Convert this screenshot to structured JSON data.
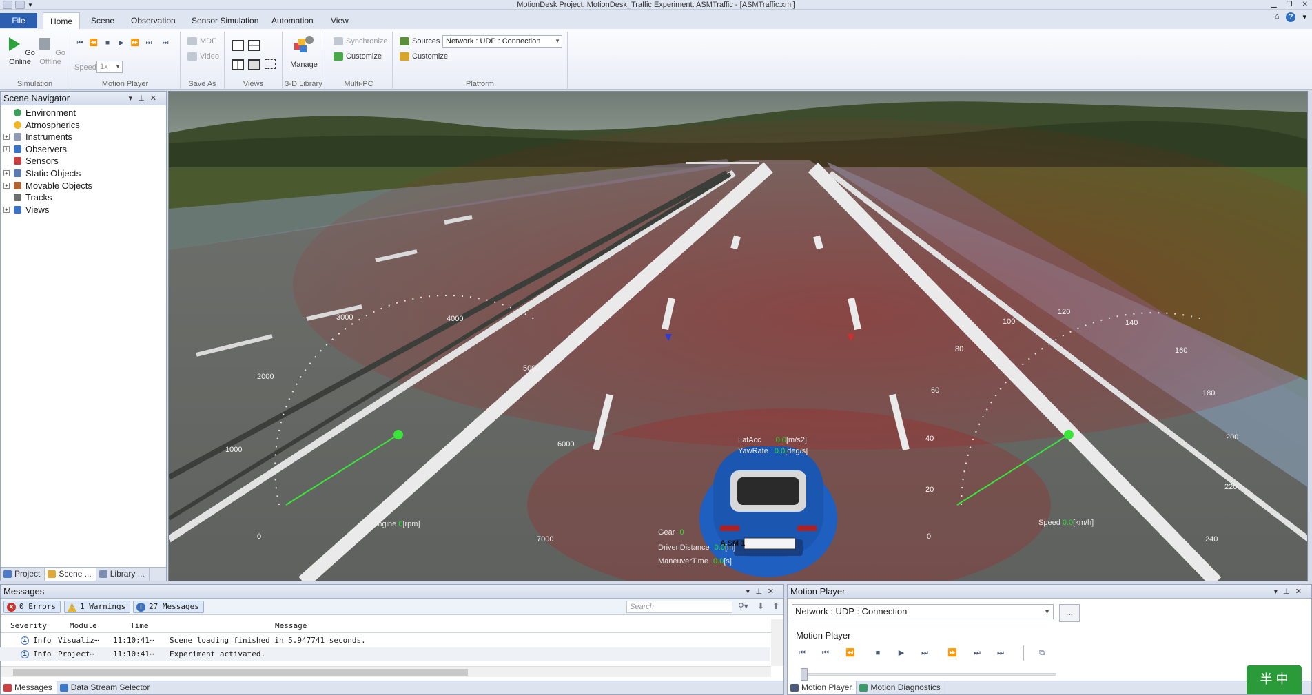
{
  "window": {
    "title": "MotionDesk  Project: MotionDesk_Traffic  Experiment: ASMTraffic - [ASMTraffic.xml]"
  },
  "ribbon": {
    "tabs": [
      {
        "label": "File"
      },
      {
        "label": "Home"
      },
      {
        "label": "Scene"
      },
      {
        "label": "Observation"
      },
      {
        "label": "Sensor Simulation"
      },
      {
        "label": "Automation"
      },
      {
        "label": "View"
      }
    ],
    "active_tab": "Home",
    "groups": {
      "simulation": {
        "label": "Simulation",
        "go_online": "Go Online",
        "go_offline": "Go Offline"
      },
      "motion_player": {
        "label": "Motion Player",
        "speed_label": "Speed",
        "speed_value": "1x"
      },
      "save_as": {
        "label": "Save As",
        "mdf": "MDF",
        "video": "Video"
      },
      "views": {
        "label": "Views"
      },
      "library": {
        "label": "3-D Library",
        "manage": "Manage"
      },
      "multipc": {
        "label": "Multi-PC",
        "synchronize": "Synchronize",
        "customize": "Customize"
      },
      "platform": {
        "label": "Platform",
        "sources": "Sources",
        "connection": "Network : UDP : Connection",
        "customize": "Customize"
      }
    }
  },
  "scene_navigator": {
    "title": "Scene Navigator",
    "items": [
      {
        "label": "Environment",
        "expandable": false
      },
      {
        "label": "Atmospherics",
        "expandable": false
      },
      {
        "label": "Instruments",
        "expandable": true
      },
      {
        "label": "Observers",
        "expandable": true
      },
      {
        "label": "Sensors",
        "expandable": false
      },
      {
        "label": "Static Objects",
        "expandable": true
      },
      {
        "label": "Movable Objects",
        "expandable": true
      },
      {
        "label": "Tracks",
        "expandable": false
      },
      {
        "label": "Views",
        "expandable": true
      }
    ],
    "bottom_tabs": [
      {
        "label": "Project"
      },
      {
        "label": "Scene ..."
      },
      {
        "label": "Library ..."
      }
    ]
  },
  "viewport": {
    "rpm_gauge": {
      "ticks": [
        "0",
        "1000",
        "2000",
        "3000",
        "4000",
        "5000",
        "6000",
        "7000"
      ],
      "label": "Engine",
      "value": "0",
      "unit": "[rpm]"
    },
    "speed_gauge": {
      "ticks": [
        "0",
        "20",
        "40",
        "60",
        "80",
        "100",
        "120",
        "140",
        "160",
        "180",
        "200",
        "220",
        "240"
      ],
      "label": "Speed",
      "value": "0.0",
      "unit": "[km/h]"
    },
    "hud": {
      "lat_acc": {
        "label": "LatAcc",
        "value": "0.0",
        "unit": "[m/s2]"
      },
      "yaw_rate": {
        "label": "YawRate",
        "value": "0.0",
        "unit": "[deg/s]"
      },
      "gear": {
        "label": "Gear",
        "value": "0"
      },
      "driven_distance": {
        "label": "DrivenDistance",
        "value": "0.0",
        "unit": "[m]"
      },
      "maneuver_time": {
        "label": "ManeuverTime",
        "value": "0.0",
        "unit": "[s]"
      }
    },
    "license_plate": "A SM 1",
    "colors": {
      "car": "#1f5fc0",
      "gauge_needle": "#39e639",
      "sensor_zone": "#b01818"
    }
  },
  "messages": {
    "title": "Messages",
    "filters": {
      "errors": "0 Errors",
      "warnings": "1 Warnings",
      "messages": "27 Messages"
    },
    "search_placeholder": "Search",
    "columns": [
      "Severity",
      "Module",
      "Time",
      "Message"
    ],
    "rows": [
      {
        "severity": "Info",
        "module": "Visualiz⋯",
        "time": "11:10:41⋯",
        "message": "Scene loading finished in 5.947741 seconds."
      },
      {
        "severity": "Info",
        "module": "Project⋯",
        "time": "11:10:41⋯",
        "message": "Experiment activated."
      }
    ],
    "bottom_tabs": [
      {
        "label": "Messages"
      },
      {
        "label": "Data Stream Selector"
      }
    ]
  },
  "motion_player_panel": {
    "title": "Motion Player",
    "connection": "Network : UDP : Connection",
    "more_label": "...",
    "inner_title": "Motion Player",
    "bottom_tabs": [
      {
        "label": "Motion Player"
      },
      {
        "label": "Motion Diagnostics"
      }
    ]
  },
  "ime": {
    "label": "半 中"
  }
}
